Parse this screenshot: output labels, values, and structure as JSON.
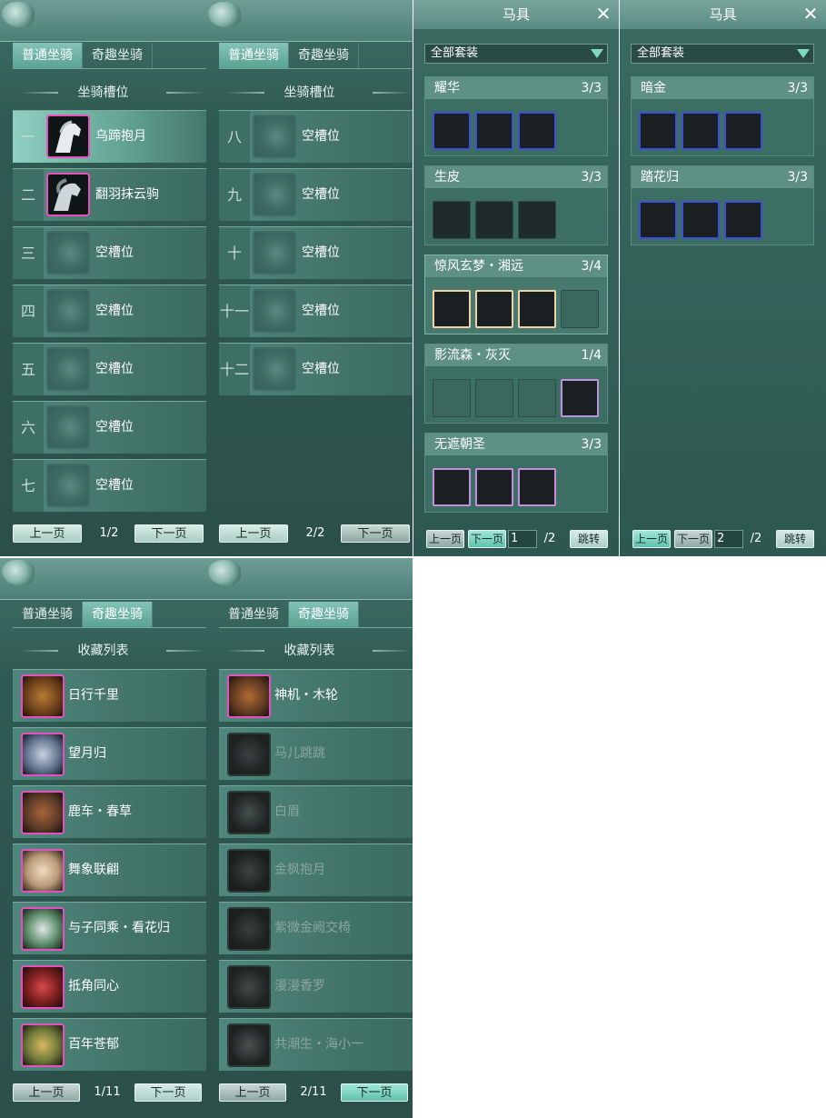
{
  "mount_panels": [
    {
      "tabs": [
        "普通坐骑",
        "奇趣坐骑"
      ],
      "section_title": "坐骑槽位",
      "slots": [
        {
          "num": "一",
          "name": "乌蹄抱月"
        },
        {
          "num": "二",
          "name": "翻羽抹云驹"
        },
        {
          "num": "三",
          "name": "空槽位"
        },
        {
          "num": "四",
          "name": "空槽位"
        },
        {
          "num": "五",
          "name": "空槽位"
        },
        {
          "num": "六",
          "name": "空槽位"
        },
        {
          "num": "七",
          "name": "空槽位"
        }
      ],
      "prev": "上一页",
      "next": "下一页",
      "page": "1/2"
    },
    {
      "tabs": [
        "普通坐骑",
        "奇趣坐骑"
      ],
      "section_title": "坐骑槽位",
      "slots": [
        {
          "num": "八",
          "name": "空槽位"
        },
        {
          "num": "九",
          "name": "空槽位"
        },
        {
          "num": "十",
          "name": "空槽位"
        },
        {
          "num": "十一",
          "name": "空槽位"
        },
        {
          "num": "十二",
          "name": "空槽位"
        }
      ],
      "prev": "上一页",
      "next": "下一页",
      "page": "2/2"
    }
  ],
  "equip_panels": [
    {
      "title": "马具",
      "close": "✕",
      "filter": "全部套装",
      "sets": [
        {
          "name": "耀华",
          "count": "3/3"
        },
        {
          "name": "生皮",
          "count": "3/3"
        },
        {
          "name": "惊风玄梦・湘远",
          "count": "3/4"
        },
        {
          "name": "影流森・灰灭",
          "count": "1/4"
        },
        {
          "name": "无遮朝圣",
          "count": "3/3"
        }
      ],
      "prev": "上一页",
      "next": "下一页",
      "page_value": "1",
      "page_total": "/2",
      "jump": "跳转"
    },
    {
      "title": "马具",
      "close": "✕",
      "filter": "全部套装",
      "sets": [
        {
          "name": "暗金",
          "count": "3/3"
        },
        {
          "name": "踏花归",
          "count": "3/3"
        }
      ],
      "prev": "上一页",
      "next": "下一页",
      "page_value": "2",
      "page_total": "/2",
      "jump": "跳转"
    }
  ],
  "collection_panels": [
    {
      "tabs": [
        "普通坐骑",
        "奇趣坐骑"
      ],
      "section_title": "收藏列表",
      "items": [
        "日行千里",
        "望月归",
        "鹿车・春草",
        "舞象联翩",
        "与子同乘・看花归",
        "抵角同心",
        "百年苍郁"
      ],
      "prev": "上一页",
      "next": "下一页",
      "page": "1/11"
    },
    {
      "tabs": [
        "普通坐骑",
        "奇趣坐骑"
      ],
      "section_title": "收藏列表",
      "items": [
        "神机・木轮",
        "马儿跳跳",
        "白眉",
        "金枫抱月",
        "紫微金阙交椅",
        "漫漫香罗",
        "共潮生・海小一"
      ],
      "prev": "上一页",
      "next": "下一页",
      "page": "2/11"
    }
  ]
}
